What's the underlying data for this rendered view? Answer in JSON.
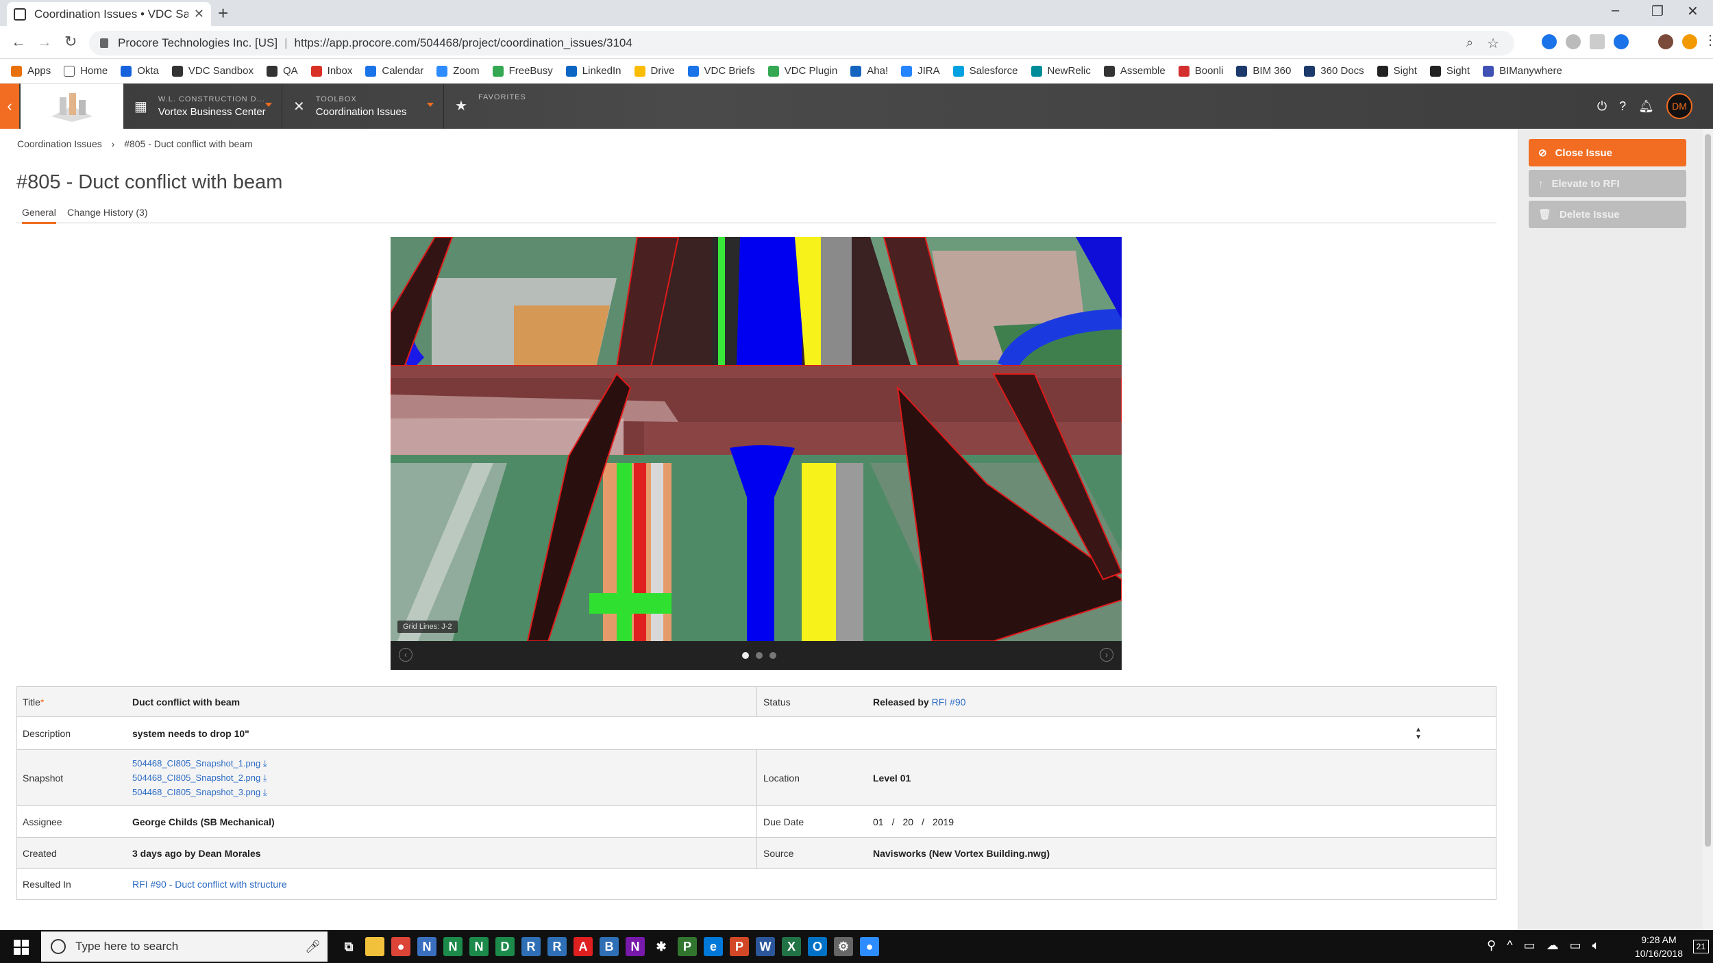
{
  "browser": {
    "tab_title": "Coordination Issues • VDC Sandb",
    "site_org": "Procore Technologies Inc. [US]",
    "url": "https://app.procore.com/504468/project/coordination_issues/3104",
    "bookmarks": [
      {
        "label": "Apps",
        "icon": "apps-grid-icon",
        "color": "#e8710a"
      },
      {
        "label": "Home",
        "icon": "page-icon",
        "color": "#ffffff"
      },
      {
        "label": "Okta",
        "icon": "okta-icon",
        "color": "#1662dd"
      },
      {
        "label": "VDC Sandbox",
        "icon": "procore-icon",
        "color": "#333333"
      },
      {
        "label": "QA",
        "icon": "procore-icon",
        "color": "#333333"
      },
      {
        "label": "Inbox",
        "icon": "gmail-icon",
        "color": "#d93025"
      },
      {
        "label": "Calendar",
        "icon": "calendar-icon",
        "color": "#1a73e8"
      },
      {
        "label": "Zoom",
        "icon": "zoom-icon",
        "color": "#2d8cff"
      },
      {
        "label": "FreeBusy",
        "icon": "freebusy-icon",
        "color": "#34a853"
      },
      {
        "label": "LinkedIn",
        "icon": "linkedin-icon",
        "color": "#0a66c2"
      },
      {
        "label": "Drive",
        "icon": "drive-icon",
        "color": "#fbbc04"
      },
      {
        "label": "VDC Briefs",
        "icon": "briefs-icon",
        "color": "#1a73e8"
      },
      {
        "label": "VDC Plugin",
        "icon": "drive-icon",
        "color": "#34a853"
      },
      {
        "label": "Aha!",
        "icon": "aha-icon",
        "color": "#1565c0"
      },
      {
        "label": "JIRA",
        "icon": "jira-icon",
        "color": "#2684ff"
      },
      {
        "label": "Salesforce",
        "icon": "salesforce-icon",
        "color": "#00a1e0"
      },
      {
        "label": "NewRelic",
        "icon": "newrelic-icon",
        "color": "#008c99"
      },
      {
        "label": "Assemble",
        "icon": "assemble-icon",
        "color": "#333333"
      },
      {
        "label": "Boonli",
        "icon": "boonli-icon",
        "color": "#d32f2f"
      },
      {
        "label": "BIM 360",
        "icon": "bim360-icon",
        "color": "#1b3a6b"
      },
      {
        "label": "360 Docs",
        "icon": "bim360-icon",
        "color": "#1b3a6b"
      },
      {
        "label": "Sight",
        "icon": "sight-icon",
        "color": "#222222"
      },
      {
        "label": "Sight",
        "icon": "sight-icon",
        "color": "#222222"
      },
      {
        "label": "BIManywhere",
        "icon": "bimanywhere-icon",
        "color": "#3f51b5"
      }
    ]
  },
  "app": {
    "company_small": "W.L. CONSTRUCTION D...",
    "company_name": "Vortex Business Center",
    "toolbox_small": "TOOLBOX",
    "toolbox_name": "Coordination Issues",
    "favorites": "FAVORITES",
    "avatar_initials": "DM"
  },
  "page": {
    "breadcrumb_root": "Coordination Issues",
    "breadcrumb_sep": "›",
    "breadcrumb_current": "#805 - Duct conflict with beam",
    "title": "#805 - Duct conflict with beam",
    "tabs": [
      "General",
      "Change History (3)"
    ],
    "viewer_grid_label": "Grid Lines: J-2",
    "viewer_slide_count": 3,
    "viewer_active_slide": 1
  },
  "actions": {
    "close": "Close Issue",
    "elevate": "Elevate to RFI",
    "delete": "Delete Issue"
  },
  "fields": {
    "title_label": "Title",
    "title_value": "Duct conflict with beam",
    "status_label": "Status",
    "status_prefix": "Released by",
    "status_link": "RFI #90",
    "description_label": "Description",
    "description_value": "system needs to drop 10\"",
    "snapshot_label": "Snapshot",
    "snapshots": [
      "504468_CI805_Snapshot_1.png",
      "504468_CI805_Snapshot_2.png",
      "504468_CI805_Snapshot_3.png"
    ],
    "location_label": "Location",
    "location_value": "Level 01",
    "assignee_label": "Assignee",
    "assignee_value": "George Childs (SB Mechanical)",
    "due_label": "Due Date",
    "due_month": "01",
    "due_day": "20",
    "due_year": "2019",
    "date_sep": "/",
    "created_label": "Created",
    "created_value": "3 days ago by Dean Morales",
    "source_label": "Source",
    "source_value": "Navisworks (New Vortex Building.nwg)",
    "resulted_label": "Resulted In",
    "resulted_value": "RFI #90 - Duct conflict with structure"
  },
  "taskbar": {
    "search_placeholder": "Type here to search",
    "time": "9:28 AM",
    "date": "10/16/2018",
    "notification_count": "21"
  },
  "colors": {
    "accent": "#f26d21",
    "link": "#2c6bc4",
    "disabled_button": "#bdbdbd"
  }
}
